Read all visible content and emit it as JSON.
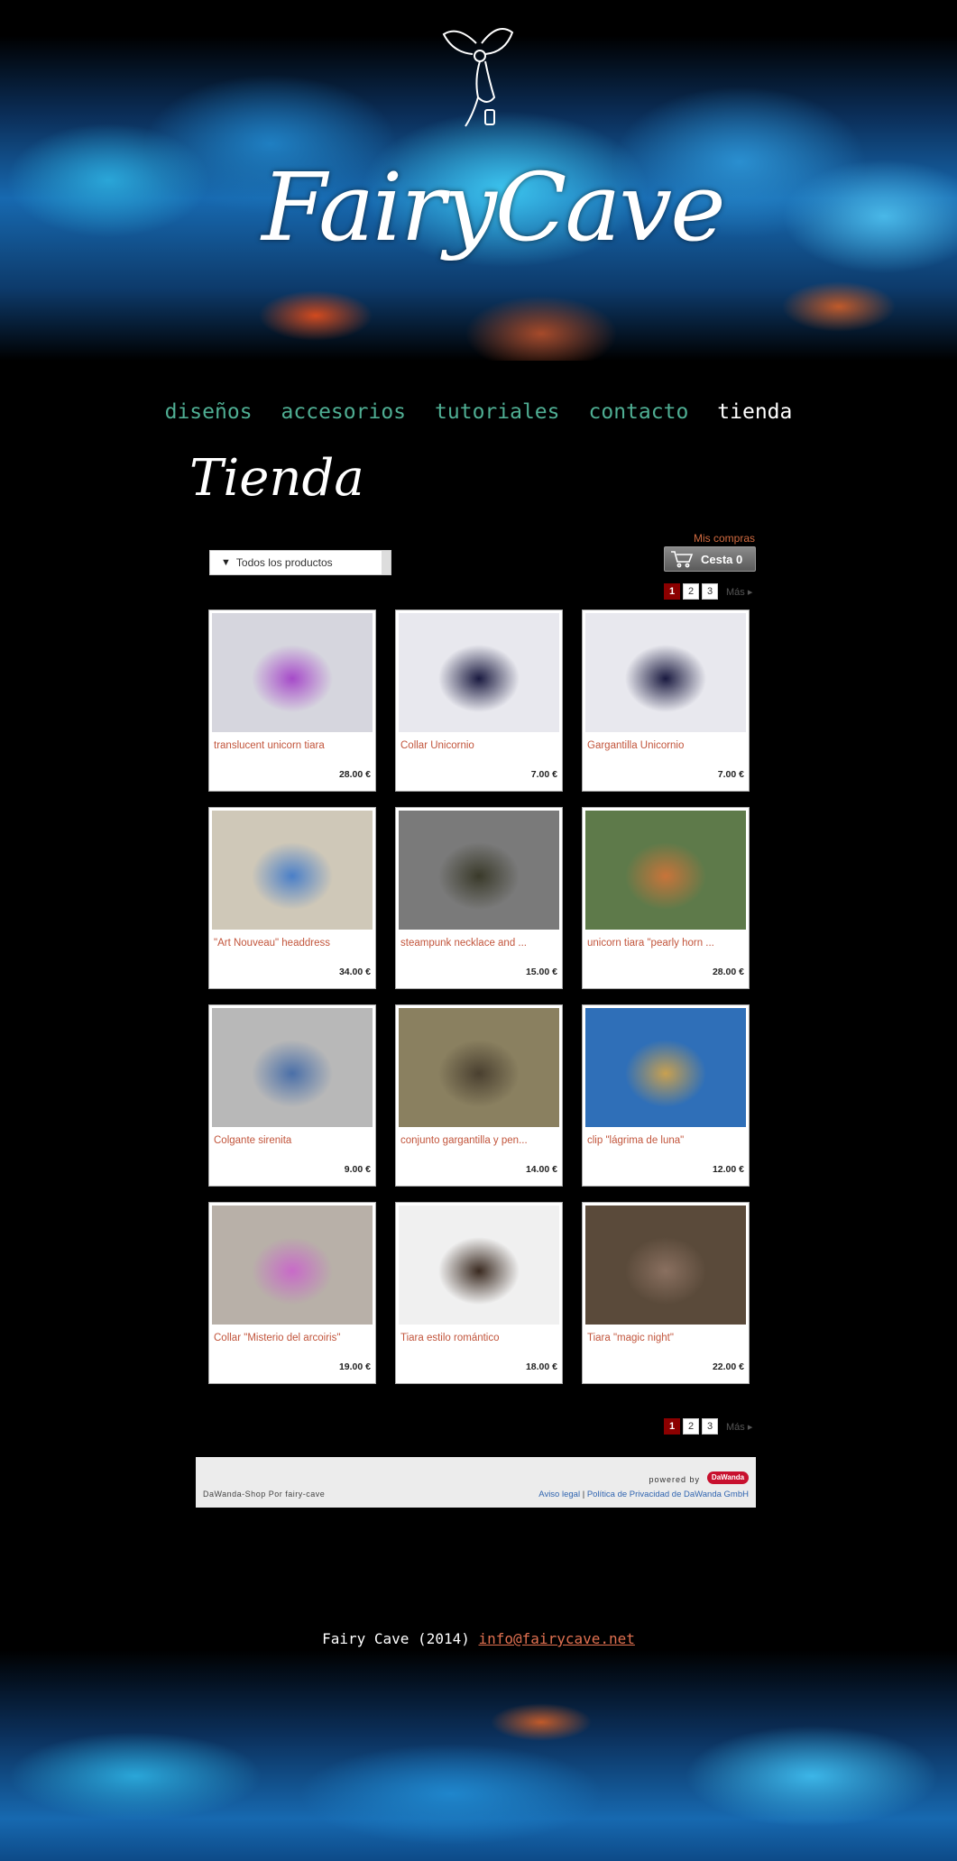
{
  "site": {
    "logo_text": "FairyCave",
    "nav": [
      "diseños",
      "accesorios",
      "tutoriales",
      "contacto",
      "tienda"
    ],
    "active_nav": "tienda"
  },
  "page": {
    "title": "Tienda"
  },
  "shop": {
    "mis_compras": "Mis compras",
    "cart_label": "Cesta 0",
    "category_filter": "Todos los productos",
    "pagination": {
      "current": "1",
      "pages": [
        "1",
        "2",
        "3"
      ],
      "more": "Más"
    }
  },
  "products": [
    {
      "title": "translucent unicorn tiara",
      "price": "28.00 €",
      "image": "purple-wig-unicorn-tiara"
    },
    {
      "title": "Collar Unicornio",
      "price": "7.00 €",
      "image": "unicorn-necklace-on-bust"
    },
    {
      "title": "Gargantilla Unicornio",
      "price": "7.00 €",
      "image": "unicorn-choker-on-bust"
    },
    {
      "title": "\"Art Nouveau\" headdress",
      "price": "34.00 €",
      "image": "flower-headdress"
    },
    {
      "title": "steampunk necklace and ...",
      "price": "15.00 €",
      "image": "steampunk-necklace"
    },
    {
      "title": "unicorn tiara \"pearly horn ...",
      "price": "28.00 €",
      "image": "unicorn-tiara-pearly-horn"
    },
    {
      "title": "Colgante sirenita",
      "price": "9.00 €",
      "image": "mermaid-pendant"
    },
    {
      "title": "conjunto gargantilla y pen...",
      "price": "14.00 €",
      "image": "choker-set"
    },
    {
      "title": "clip \"lágrima de luna\"",
      "price": "12.00 €",
      "image": "hair-clip-blue-hair"
    },
    {
      "title": "Collar \"Misterio del arcoiris\"",
      "price": "19.00 €",
      "image": "rainbow-necklace"
    },
    {
      "title": "Tiara estilo romántico",
      "price": "18.00 €",
      "image": "romantic-tiara"
    },
    {
      "title": "Tiara \"magic night\"",
      "price": "22.00 €",
      "image": "magic-night-tiara"
    }
  ],
  "footer": {
    "powered_by": "powered by",
    "dawanda_logo": "DaWanda",
    "shop_credit": "DaWanda-Shop Por fairy-cave",
    "aviso_legal": "Aviso legal",
    "separator": "|",
    "privacy": "Política de Privacidad de DaWanda GmbH",
    "copyright": "Fairy Cave (2014)",
    "email": "info@fairycave.net"
  },
  "colors": {
    "nav": "#4fae93",
    "nav_active": "#ffffff",
    "product_title": "#c2553c",
    "pager_current": "#8b0000",
    "link_blue": "#2f64b0"
  }
}
